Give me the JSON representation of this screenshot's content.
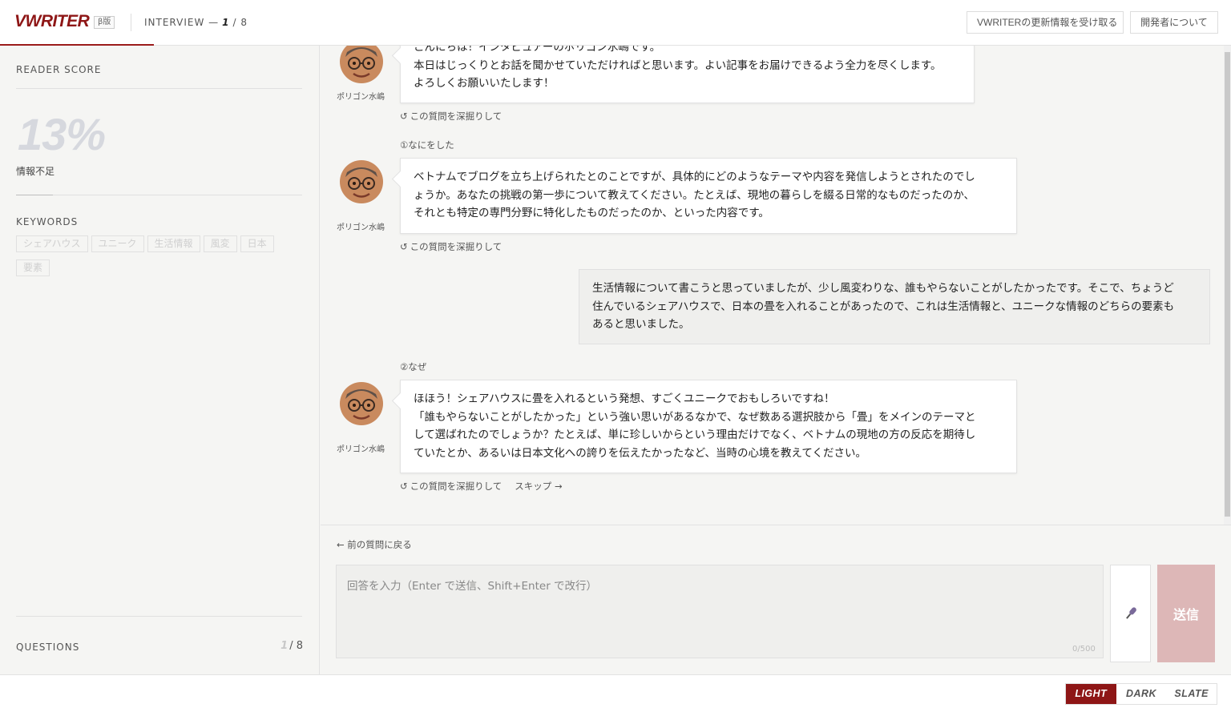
{
  "header": {
    "logo": "VWRITER",
    "beta": "β版",
    "interview_label": "INTERVIEW —",
    "current_q": "1",
    "total_q": "/ 8",
    "updates_button": "VWRITERの更新情報を受け取る",
    "about_button": "開発者について"
  },
  "sidebar": {
    "reader_score_label": "READER SCORE",
    "score": "13%",
    "score_fraction": 0.13,
    "score_status": "情報不足",
    "keywords_label": "KEYWORDS",
    "keywords": [
      "シェアハウス",
      "ユニーク",
      "生活情報",
      "風変",
      "日本",
      "要素"
    ],
    "questions_label": "QUESTIONS",
    "questions_current": "1",
    "questions_total": "/ 8"
  },
  "chat": {
    "interviewer_name": "ポリゴン水嶋",
    "deep_dive": "この質問を深掘りして",
    "deep_dive_icon": "refresh-icon",
    "skip": "スキップ →",
    "messages": [
      {
        "lines": [
          "こんにちは！インタビュアーのポリゴン水嶋です。",
          "本日はじっくりとお話を聞かせていただければと思います。よい記事をお届けできるよう全力を尽くします。",
          "よろしくお願いいたします！"
        ]
      },
      {
        "label": "①なにをした",
        "lines": [
          "ベトナムでブログを立ち上げられたとのことですが、具体的にどのようなテーマや内容を発信しようとされたのでし",
          "ょうか。あなたの挑戦の第一歩について教えてください。たとえば、現地の暮らしを綴る日常的なものだったのか、",
          "それとも特定の専門分野に特化したものだったのか、といった内容です。"
        ]
      },
      {
        "user": true,
        "lines": [
          "生活情報について書こうと思っていましたが、少し風変わりな、誰もやらないことがしたかったです。そこで、ちょうど",
          "住んでいるシェアハウスで、日本の畳を入れることがあったので、これは生活情報と、ユニークな情報のどちらの要素も",
          "あると思いました。"
        ]
      },
      {
        "label": "②なぜ",
        "lines": [
          "ほほう！シェアハウスに畳を入れるという発想、すごくユニークでおもしろいですね！",
          "「誰もやらないことがしたかった」という強い思いがあるなかで、なぜ数ある選択肢から「畳」をメインのテーマと",
          "して選ばれたのでしょうか？たとえば、単に珍しいからという理由だけでなく、ベトナムの現地の方の反応を期待し",
          "ていたとか、あるいは日本文化への誇りを伝えたかったなど、当時の心境を教えてください。"
        ]
      }
    ]
  },
  "input": {
    "back": "← 前の質問に戻る",
    "placeholder": "回答を入力（Enter で送信、Shift+Enter で改行）",
    "counter": "0/500",
    "mic_icon": "microphone-icon",
    "send": "送信"
  },
  "footer": {
    "themes": [
      "LIGHT",
      "DARK",
      "SLATE"
    ],
    "active_theme": "LIGHT"
  },
  "colors": {
    "brand": "#8e1616",
    "send_disabled": "#ddb7b7"
  }
}
